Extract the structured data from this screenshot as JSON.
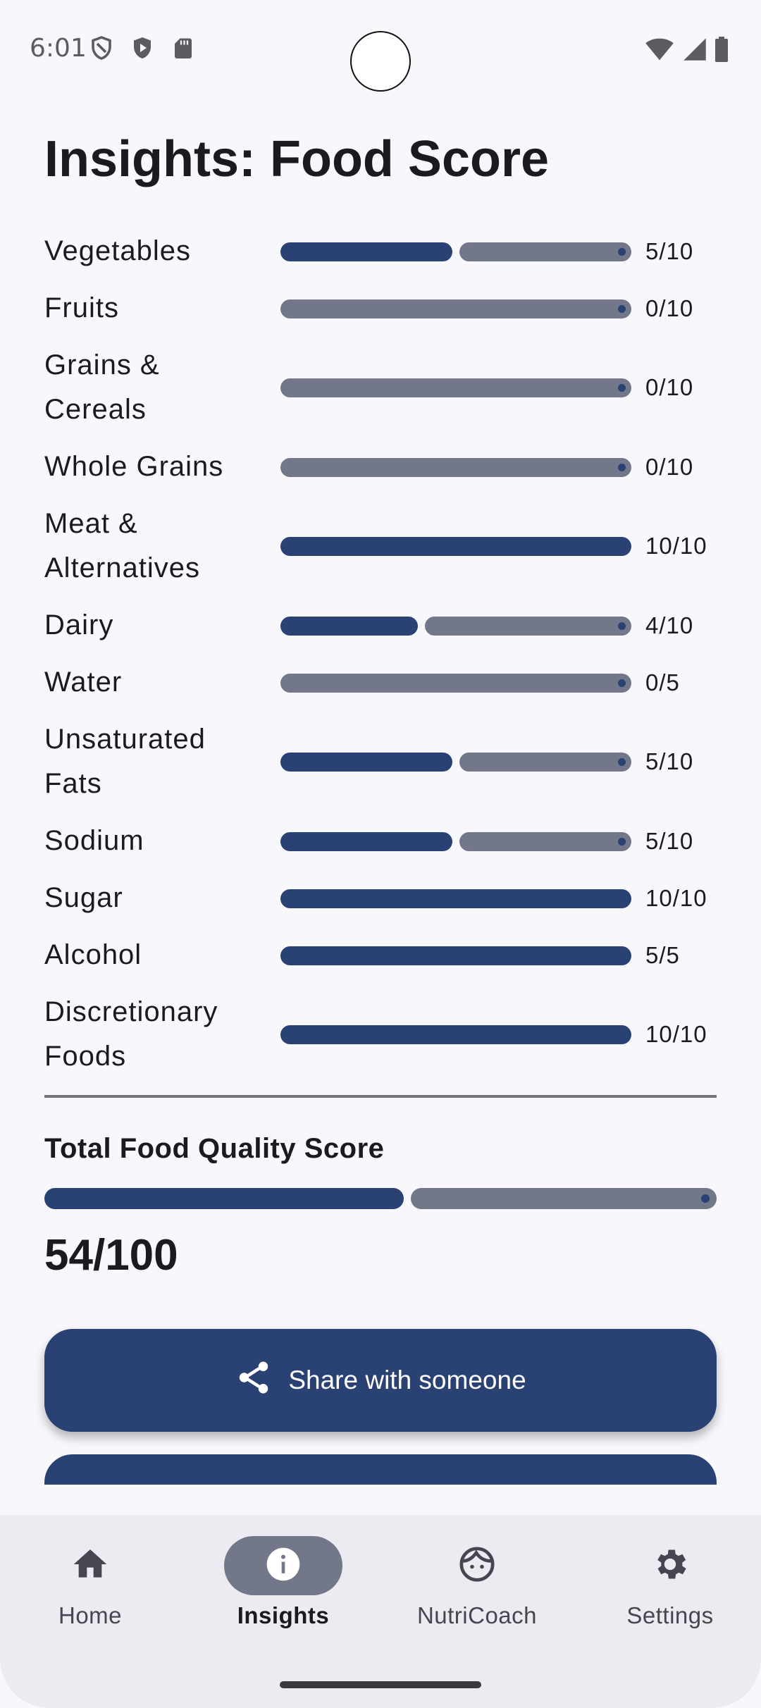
{
  "status_bar": {
    "time": "6:01",
    "left_icons": [
      "shield-icon",
      "play-protect-icon",
      "sd-card-icon"
    ],
    "right_icons": [
      "wifi-icon",
      "signal-icon",
      "battery-icon"
    ]
  },
  "page": {
    "title": "Insights: Food Score"
  },
  "scores": [
    {
      "label": "Vegetables",
      "value_text": "5/10",
      "score": 5,
      "max": 10
    },
    {
      "label": "Fruits",
      "value_text": "0/10",
      "score": 0,
      "max": 10
    },
    {
      "label": "Grains & Cereals",
      "value_text": "0/10",
      "score": 0,
      "max": 10
    },
    {
      "label": "Whole Grains",
      "value_text": "0/10",
      "score": 0,
      "max": 10
    },
    {
      "label": "Meat & Alternatives",
      "value_text": "10/10",
      "score": 10,
      "max": 10
    },
    {
      "label": "Dairy",
      "value_text": "4/10",
      "score": 4,
      "max": 10
    },
    {
      "label": "Water",
      "value_text": "0/5",
      "score": 0,
      "max": 5
    },
    {
      "label": "Unsaturated Fats",
      "value_text": "5/10",
      "score": 5,
      "max": 10
    },
    {
      "label": "Sodium",
      "value_text": "5/10",
      "score": 5,
      "max": 10
    },
    {
      "label": "Sugar",
      "value_text": "10/10",
      "score": 10,
      "max": 10
    },
    {
      "label": "Alcohol",
      "value_text": "5/5",
      "score": 5,
      "max": 5
    },
    {
      "label": "Discretionary Foods",
      "value_text": "10/10",
      "score": 10,
      "max": 10
    }
  ],
  "total": {
    "label": "Total Food Quality Score",
    "value_text": "54/100",
    "score": 54,
    "max": 100
  },
  "actions": {
    "share_label": "Share with someone"
  },
  "nav": {
    "items": [
      {
        "label": "Home",
        "icon": "home-icon",
        "active": false
      },
      {
        "label": "Insights",
        "icon": "info-icon",
        "active": true
      },
      {
        "label": "NutriCoach",
        "icon": "face-icon",
        "active": false
      },
      {
        "label": "Settings",
        "icon": "gear-icon",
        "active": false
      }
    ]
  },
  "colors": {
    "accent": "#2a4173",
    "track": "#727789",
    "background": "#f8f7fc",
    "nav_background": "#ecebf1"
  }
}
